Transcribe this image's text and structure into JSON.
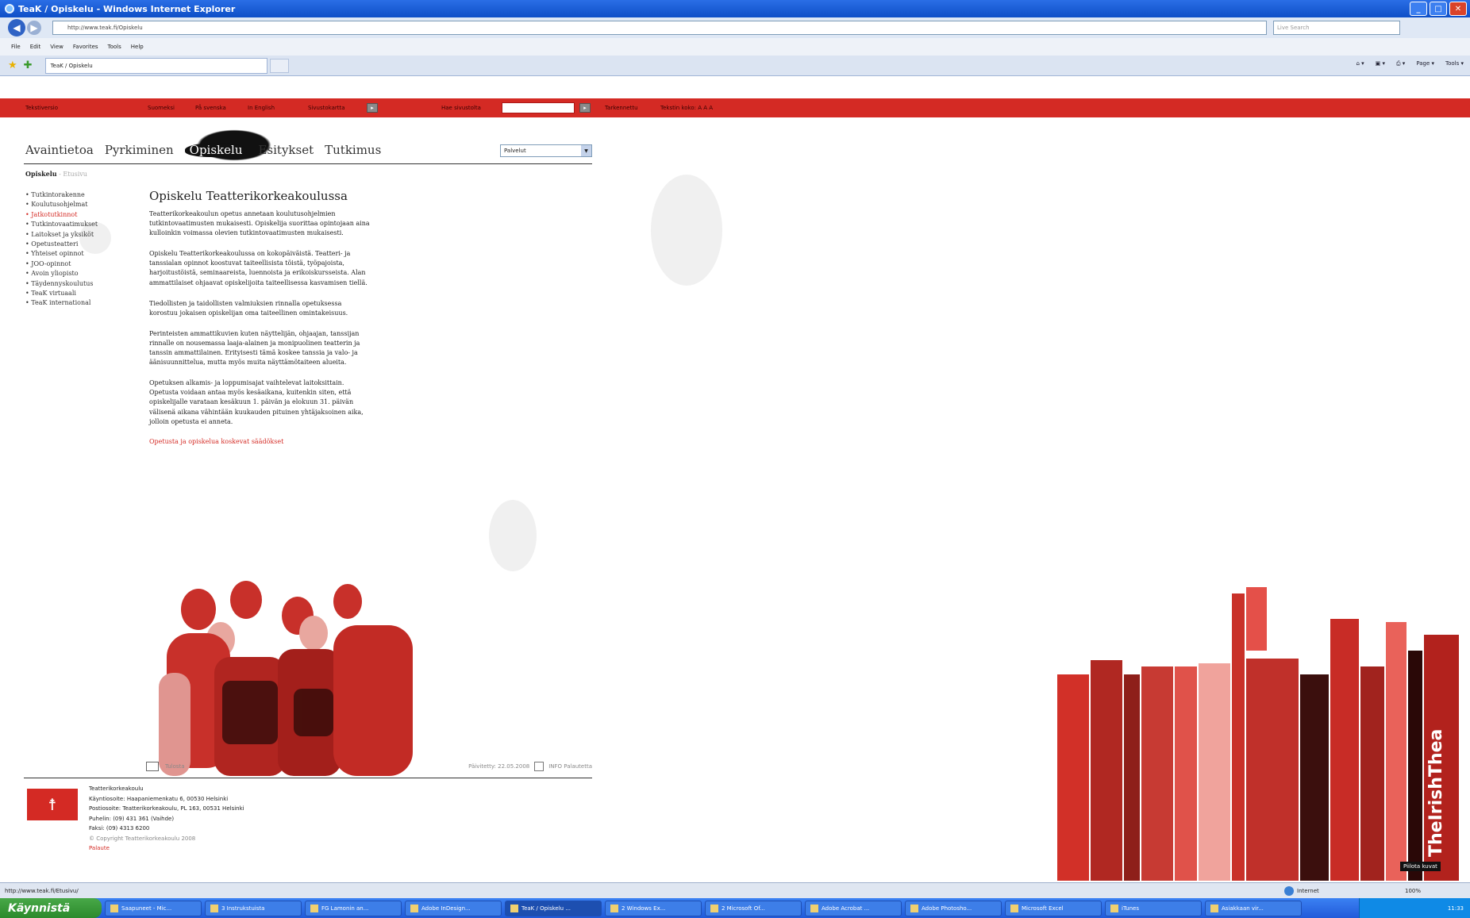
{
  "window": {
    "title": "TeaK / Opiskelu - Windows Internet Explorer"
  },
  "toolbar": {
    "url": "http://www.teak.fi/Opiskelu",
    "search_placeholder": "Live Search",
    "menu": [
      "File",
      "Edit",
      "View",
      "Favorites",
      "Tools",
      "Help"
    ],
    "tab_title": "TeaK / Opiskelu",
    "commands": [
      "Page ▾",
      "Tools ▾"
    ]
  },
  "site_bar": {
    "front_page": "Tekstiversio",
    "languages": [
      "Suomeksi",
      "På svenska",
      "In English"
    ],
    "sitemap": "Sivustokartta",
    "search_label": "Hae sivustolta",
    "advanced": "Tarkennettu",
    "font_size": "Tekstin koko: A A A"
  },
  "main_nav": {
    "items": [
      "Avaintietoa",
      "Pyrkiminen",
      "Opiskelu",
      "Esitykset",
      "Tutkimus"
    ],
    "active_index": 2,
    "services_select": "Palvelut"
  },
  "breadcrumb": {
    "current": "Opiskelu",
    "separator": "-",
    "next": "Etusivu"
  },
  "sidenav": [
    "Tutkintorakenne",
    "Koulutusohjelmat",
    "Jatkotutkinnot",
    "Tutkintovaatimukset",
    "Laitokset ja yksiköt",
    "Opetusteatteri",
    "Yhteiset opinnot",
    "JOO-opinnot",
    "Avoin yliopisto",
    "Täydennyskoulutus",
    "TeaK virtuaali",
    "TeaK international"
  ],
  "sidenav_active_index": 2,
  "article": {
    "title": "Opiskelu Teatterikorkeakoulussa",
    "paragraphs": [
      "Teatterikorkeakoulun opetus annetaan koulutusohjelmien tutkintovaatimusten mukaisesti. Opiskelija suorittaa opintojaan aina kulloinkin voimassa olevien tutkintovaatimusten mukaisesti.",
      "Opiskelu Teatterikorkeakoulussa on kokopäiväistä. Teatteri- ja tanssialan opinnot koostuvat taiteellisista töistä, työpajoista, harjoitustöistä, seminaareista, luennoista ja erikoiskursseista. Alan ammattilaiset ohjaavat opiskelijoita taiteellisessa kasvamisen tiellä.",
      "Tiedollisten ja taidollisten valmiuksien rinnalla opetuksessa korostuu jokaisen opiskelijan oma taiteellinen omintakeisuus.",
      "Perinteisten ammattikuvien kuten näyttelijän, ohjaajan, tanssijan rinnalle on nousemassa laaja-alainen ja monipuolinen teatterin ja tanssin ammattilainen. Erityisesti tämä koskee tanssia ja valo- ja äänisuunnittelua, mutta myös muita näyttämötaiteen alueita.",
      "Opetuksen alkamis- ja loppumisajat vaihtelevat laitoksittain. Opetusta voidaan antaa myös kesäaikana, kuitenkin siten, että opiskelijalle varataan kesäkuun 1. päivän ja elokuun 31. päivän välisenä aikana vähintään kuukauden pituinen yhtäjaksoinen aika, jolloin opetusta ei anneta."
    ],
    "link": "Opetusta ja opiskelua koskevat säädökset"
  },
  "page_tools": {
    "print": "Tulosta",
    "updated": "Päivitetty: 22.05.2008",
    "info": "INFO Palautetta"
  },
  "footer": {
    "name": "Teatterikorkeakoulu",
    "lines": [
      "Käyntiosoite: Haapaniemenkatu 6, 00530 Helsinki",
      "Postiosoite: Teatterikorkeakoulu, PL 163, 00531 Helsinki",
      "Puhelin: (09) 431 361 (Vaihde)",
      "Faksi: (09) 4313 6200"
    ],
    "copyright": "© Copyright Teatterikorkeakoulu 2008",
    "feedback": "Palaute"
  },
  "book_spine_text": "TheIrishThea",
  "tooltip": "Piilota kuvat",
  "status": {
    "url": "http://www.teak.fi/Etusivu/",
    "zone": "Internet",
    "zoom": "100%"
  },
  "taskbar": {
    "start": "Käynnistä",
    "items": [
      "Saapuneet - Mic...",
      "3 Instrukstuista",
      "FG Lamonin an...",
      "Adobe InDesign...",
      "TeaK / Opiskelu ...",
      "2 Windows Ex...",
      "2 Microsoft Of...",
      "Adobe Acrobat ...",
      "Adobe Photosho...",
      "Microsoft Excel",
      "iTunes",
      "Asiakkaan vir..."
    ],
    "active_index": 4,
    "clock": "11:33"
  },
  "colors": {
    "brand_red": "#d42a24",
    "xp_blue": "#2a6ee6"
  }
}
